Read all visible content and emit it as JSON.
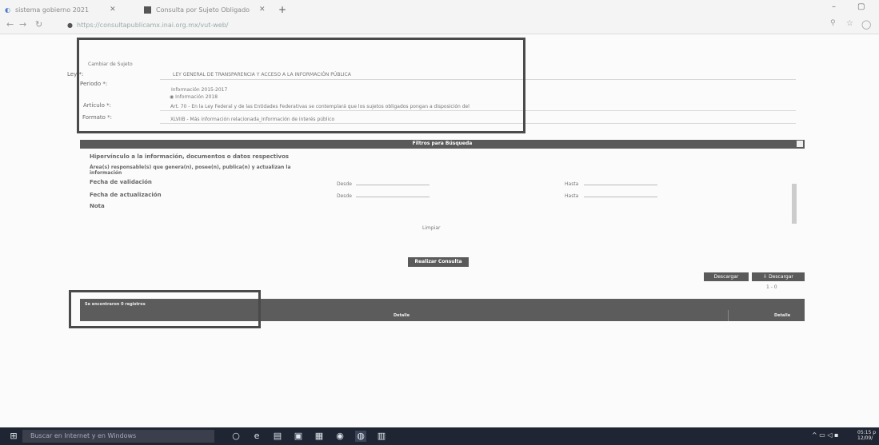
{
  "browser": {
    "tabs": [
      {
        "title": "sistema gobierno 2021"
      },
      {
        "title": "Consulta por Sujeto Obligado"
      }
    ],
    "new_tab": "+",
    "url": "https://consultapublicamx.inai.org.mx/vut-web/",
    "window_controls": {
      "minimize": "–",
      "maximize": "▢"
    }
  },
  "form": {
    "header_link": "Cambiar de Sujeto",
    "rows": [
      {
        "label": "Ley *:",
        "value": "LEY GENERAL DE TRANSPARENCIA Y ACCESO A LA INFORMACIÓN PÚBLICA"
      },
      {
        "label": "Periodo *:",
        "options": [
          "Información 2015-2017",
          "Información 2018"
        ],
        "selected": 1
      },
      {
        "label": "Artículo *:",
        "value": "Art. 70 - En la Ley Federal y de las Entidades Federativas se contemplará que los sujetos obligados pongan a disposición del"
      },
      {
        "label": "Formato *:",
        "value": "XLVIIB - Más información relacionada_Información de interés público"
      }
    ]
  },
  "filters": {
    "title": "Filtros para Búsqueda",
    "fields": [
      {
        "label": "Hipervínculo a la información, documentos o datos respectivos"
      },
      {
        "label": "Área(s) responsable(s) que genera(n), posee(n), publica(n) y actualizan la información"
      },
      {
        "label": "Fecha de validación",
        "desde": "Desde",
        "hasta": "Hasta"
      },
      {
        "label": "Fecha de actualización",
        "desde": "Desde",
        "hasta": "Hasta"
      },
      {
        "label": "Nota"
      }
    ],
    "clear": "Limpiar",
    "submit": "Realizar Consulta"
  },
  "downloads": {
    "btn1": "Descargar",
    "btn2": "Descargar",
    "pager": "1 - 0"
  },
  "results": {
    "count_label": "Se encontraron 0 registros",
    "columns": [
      "Detalle",
      "Detalle"
    ]
  },
  "taskbar": {
    "search_placeholder": "Buscar en Internet y en Windows",
    "time": "05:15 p",
    "date": "12/09/"
  },
  "colors": {
    "dark_bar": "#5a5a5a",
    "highlight_box": "#4a4a4a",
    "taskbar": "#1f2532"
  }
}
